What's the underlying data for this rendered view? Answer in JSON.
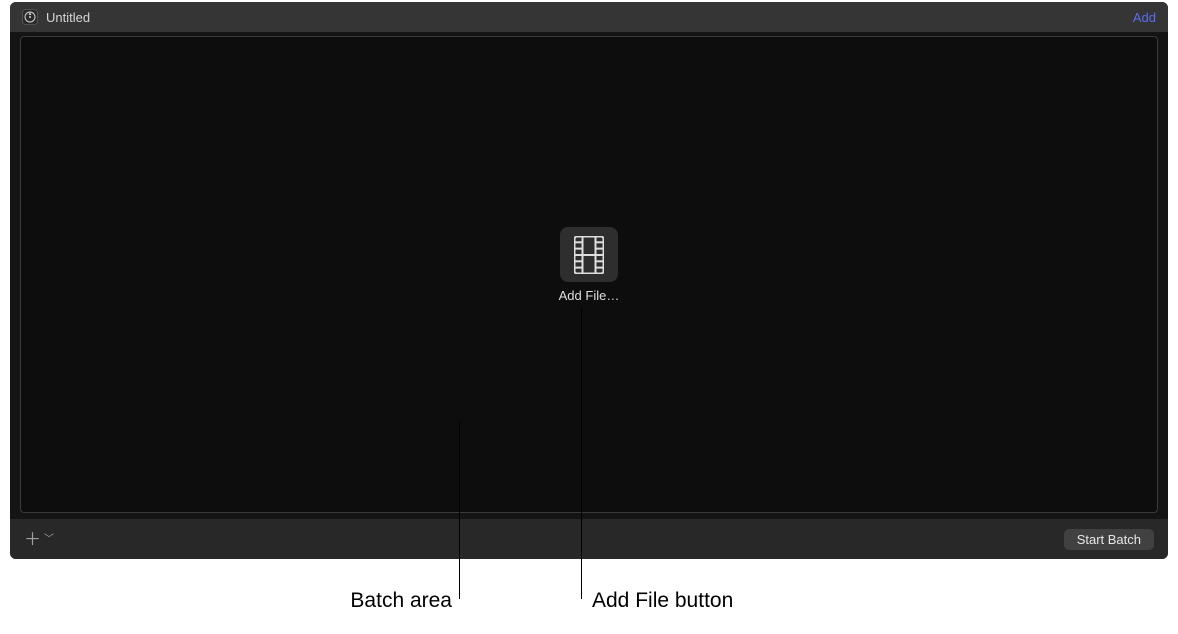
{
  "titlebar": {
    "title": "Untitled",
    "add_link": "Add"
  },
  "batch": {
    "addfile_label": "Add File…"
  },
  "footer": {
    "plus_symbol": "＋",
    "start_batch": "Start Batch"
  },
  "annotations": {
    "batch_area": "Batch area",
    "add_file_button": "Add File button"
  }
}
